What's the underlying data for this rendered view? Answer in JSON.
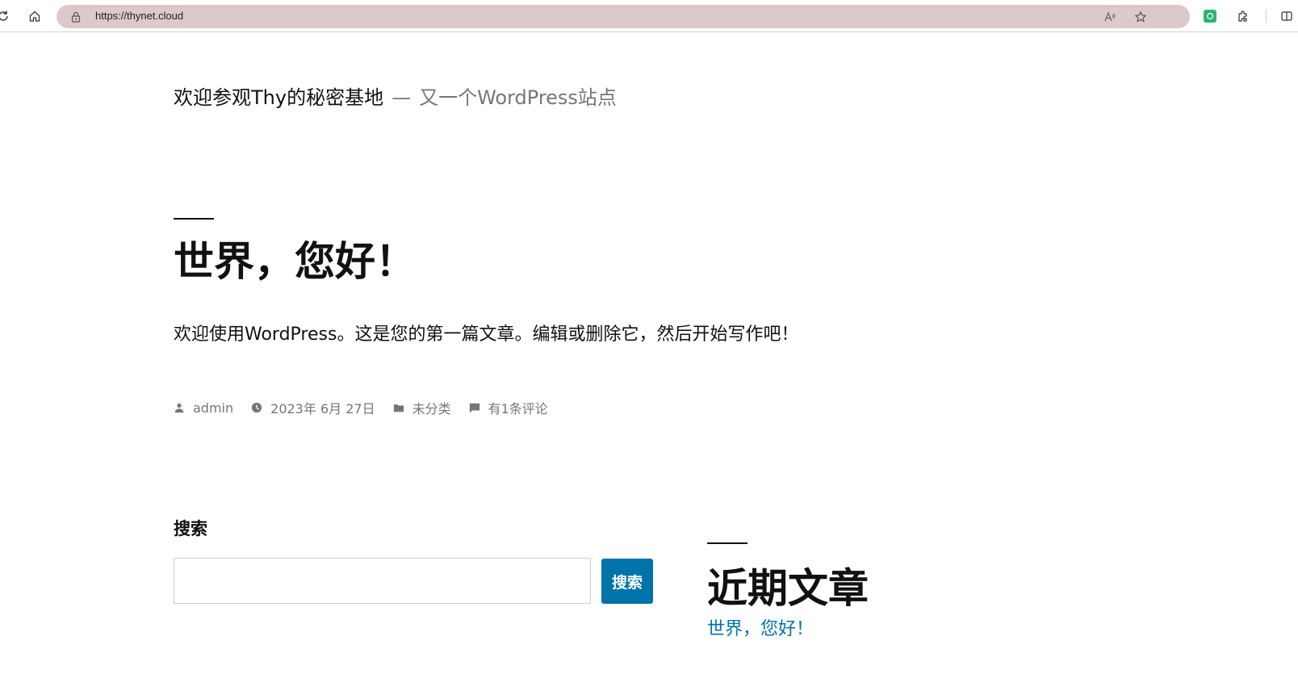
{
  "browser": {
    "url": "https://thynet.cloud",
    "icons": [
      "reload-icon",
      "home-icon",
      "lock-icon",
      "read-aloud-icon",
      "favorite-star-icon",
      "extension-green-icon",
      "extensions-puzzle-icon",
      "split-screen-icon"
    ]
  },
  "site": {
    "title": "欢迎参观Thy的秘密基地",
    "separator": "—",
    "description": "又一个WordPress站点"
  },
  "post": {
    "title": "世界，您好！",
    "body": "欢迎使用WordPress。这是您的第一篇文章。编辑或删除它，然后开始写作吧！",
    "meta": {
      "author": "admin",
      "date": "2023年 6月 27日",
      "category": "未分类",
      "comments": "有1条评论"
    }
  },
  "search_widget": {
    "label": "搜索",
    "input_value": "",
    "button_label": "搜索"
  },
  "recent_posts": {
    "title": "近期文章",
    "items": [
      "世界，您好！"
    ]
  },
  "colors": {
    "accent": "#0073aa",
    "address_bar": "#dcc9c9",
    "meta_text": "#767676"
  }
}
